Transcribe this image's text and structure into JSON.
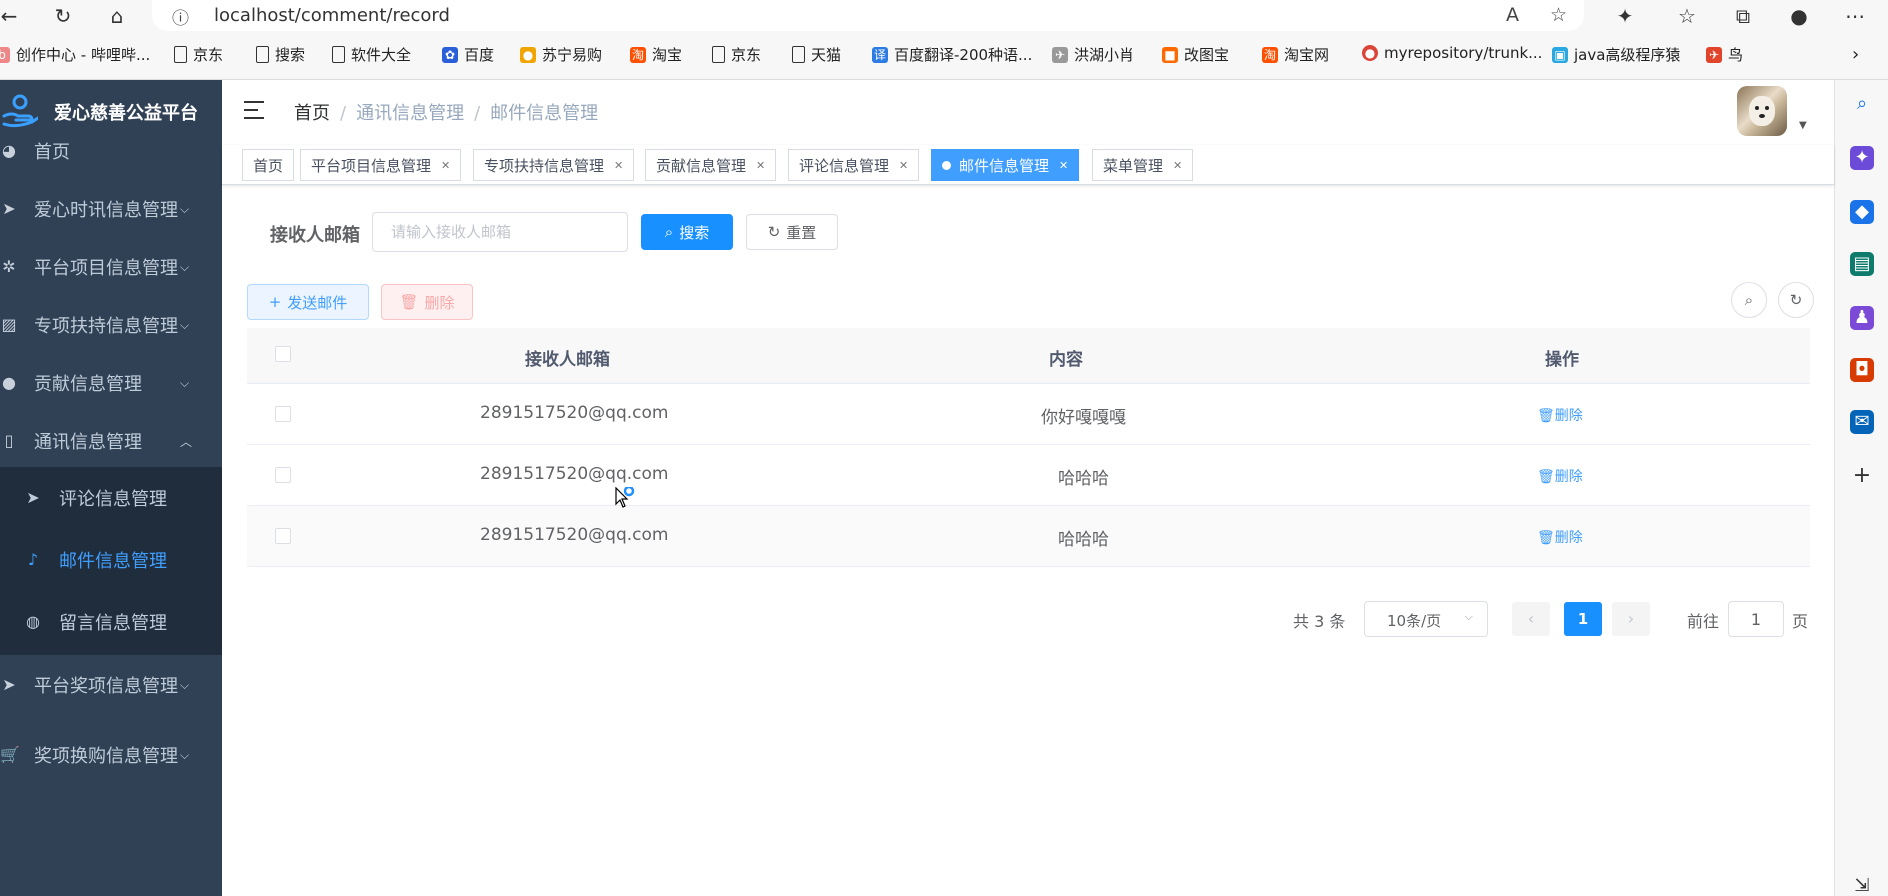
{
  "browser": {
    "url": "localhost/comment/record",
    "bookmarks": [
      "创作中心 - 哔哩哔...",
      "京东",
      "搜索",
      "软件大全",
      "百度",
      "苏宁易购",
      "淘宝",
      "京东",
      "天猫",
      "百度翻译-200种语...",
      "洪湖小肖",
      "改图宝",
      "淘宝网",
      "myrepository/trunk...",
      "java高级程序猿",
      "鸟"
    ]
  },
  "sidebar": {
    "title": "爱心慈善公益平台",
    "items": [
      {
        "label": "首页"
      },
      {
        "label": "爱心时讯信息管理"
      },
      {
        "label": "平台项目信息管理"
      },
      {
        "label": "专项扶持信息管理"
      },
      {
        "label": "贡献信息管理"
      },
      {
        "label": "通讯信息管理"
      },
      {
        "label": "平台奖项信息管理"
      },
      {
        "label": "奖项换购信息管理"
      }
    ],
    "submenu": [
      {
        "label": "评论信息管理"
      },
      {
        "label": "邮件信息管理"
      },
      {
        "label": "留言信息管理"
      }
    ]
  },
  "breadcrumb": [
    "首页",
    "通讯信息管理",
    "邮件信息管理"
  ],
  "tags": [
    {
      "label": "首页"
    },
    {
      "label": "平台项目信息管理"
    },
    {
      "label": "专项扶持信息管理"
    },
    {
      "label": "贡献信息管理"
    },
    {
      "label": "评论信息管理"
    },
    {
      "label": "邮件信息管理"
    },
    {
      "label": "菜单管理"
    }
  ],
  "search": {
    "label": "接收人邮箱",
    "placeholder": "请输入接收人邮箱",
    "search_btn": "搜索",
    "reset_btn": "重置"
  },
  "toolbar": {
    "add_btn": "发送邮件",
    "delete_btn": "删除"
  },
  "table": {
    "columns": [
      "接收人邮箱",
      "内容",
      "操作"
    ],
    "rows": [
      {
        "email": "2891517520@qq.com",
        "content": "你好嘎嘎嘎",
        "action": "删除"
      },
      {
        "email": "2891517520@qq.com",
        "content": "哈哈哈",
        "action": "删除"
      },
      {
        "email": "2891517520@qq.com",
        "content": "哈哈哈",
        "action": "删除"
      }
    ]
  },
  "pagination": {
    "total": "共 3 条",
    "page_size": "10条/页",
    "current": "1",
    "goto_label": "前往",
    "goto_value": "1",
    "page_label": "页"
  },
  "colors": {
    "sidebar_bg": "#304156",
    "primary": "#1890ff",
    "link": "#409eff"
  }
}
